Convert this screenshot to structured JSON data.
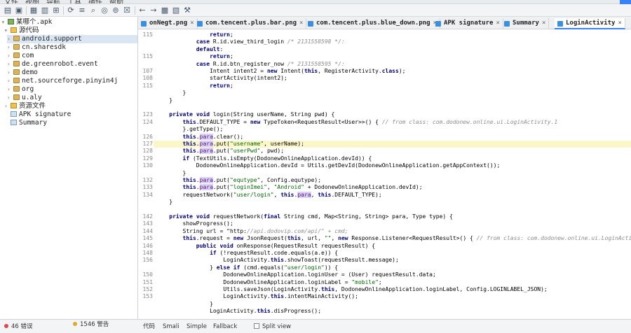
{
  "window": {
    "title_partial": "",
    "menu": [
      "文件",
      "视图",
      "导航",
      "工具",
      "插件",
      "帮助"
    ]
  },
  "toolbar": {
    "icons": [
      "open-icon",
      "add-files-icon",
      "save-icon",
      "save-all-icon",
      "export-icon",
      "sync-icon",
      "flatten-icon",
      "search-icon",
      "search-class-icon",
      "search-text-icon",
      "deobfuscation-icon",
      "back-icon",
      "forward-icon",
      "quark-icon",
      "log-icon",
      "settings-icon"
    ]
  },
  "tree": {
    "root": "某哪个.apk",
    "source_code": "源代码",
    "packages": [
      "android.support",
      "cn.sharesdk",
      "com",
      "de.greenrobot.event",
      "demo",
      "net.sourceforge.pinyin4j",
      "org",
      "u.aly"
    ],
    "resources": "资源文件",
    "apk_signature": "APK signature",
    "summary": "Summary"
  },
  "tabs": [
    {
      "label": "onNegt.png"
    },
    {
      "label": "com.tencent.plus.bar.png"
    },
    {
      "label": "com.tencent.plus.blue_down.png"
    },
    {
      "label": "APK signature"
    },
    {
      "label": "Summary"
    },
    {
      "label": "LoginActivity",
      "active": true
    }
  ],
  "code_lines": [
    {
      "ln": "115",
      "text": "                return;"
    },
    {
      "ln": "",
      "text": "            case R.id.view_third_login /* 2131558598 */:"
    },
    {
      "ln": "",
      "text": "            default:"
    },
    {
      "ln": "115",
      "text": "                return;"
    },
    {
      "ln": "",
      "text": "            case R.id.btn_register_now /* 2131558595 */:"
    },
    {
      "ln": "107",
      "text": "                Intent intent2 = new Intent(this, RegisterActivity.class);"
    },
    {
      "ln": "108",
      "text": "                startActivity(intent2);"
    },
    {
      "ln": "115",
      "text": "                return;"
    },
    {
      "ln": "",
      "text": "        }"
    },
    {
      "ln": "",
      "text": "    }"
    },
    {
      "ln": "",
      "text": ""
    },
    {
      "ln": "123",
      "text": "    private void login(String userName, String pwd) {"
    },
    {
      "ln": "124",
      "text": "        this.DEFAULT_TYPE = new TypeToken<RequestResult<User>>() { // from class: com.dodonew.online.ui.LoginActivity.1"
    },
    {
      "ln": "",
      "text": "        }.getType();"
    },
    {
      "ln": "126",
      "text": "        this.para.clear();"
    },
    {
      "ln": "127",
      "text": "        this.para.put(\"username\", userName);"
    },
    {
      "ln": "128",
      "text": "        this.para.put(\"userPwd\", pwd);"
    },
    {
      "ln": "129",
      "text": "        if (TextUtils.isEmpty(DodonewOnlineApplication.devId)) {"
    },
    {
      "ln": "130",
      "text": "            DodonewOnlineApplication.devId = Utils.getDevId(DodonewOnlineApplication.getAppContext());"
    },
    {
      "ln": "",
      "text": "        }"
    },
    {
      "ln": "132",
      "text": "        this.para.put(\"equtype\", Config.equtype);"
    },
    {
      "ln": "133",
      "text": "        this.para.put(\"loginImei\", \"Android\" + DodonewOnlineApplication.devId);"
    },
    {
      "ln": "134",
      "text": "        requestNetwork(\"user/login\", this.para, this.DEFAULT_TYPE);"
    },
    {
      "ln": "",
      "text": "    }"
    },
    {
      "ln": "",
      "text": ""
    },
    {
      "ln": "142",
      "text": "    private void requestNetwork(final String cmd, Map<String, String> para, Type type) {"
    },
    {
      "ln": "143",
      "text": "        showProgress();"
    },
    {
      "ln": "144",
      "text": "        String url = \"http://api.dodovip.com/api/\" + cmd;"
    },
    {
      "ln": "145",
      "text": "        this.request = new JsonRequest(this, url, \"\", new Response.Listener<RequestResult>() { // from class: com.dodonew.online.ui.LoginActivi"
    },
    {
      "ln": "146",
      "text": "            public void onResponse(RequestResult requestResult) {"
    },
    {
      "ln": "148",
      "text": "                if (!requestResult.code.equals(a.e)) {"
    },
    {
      "ln": "156",
      "text": "                    LoginActivity.this.showToast(requestResult.message);"
    },
    {
      "ln": "",
      "text": "                } else if (cmd.equals(\"user/login\")) {"
    },
    {
      "ln": "150",
      "text": "                    DodonewOnlineApplication.loginUser = (User) requestResult.data;"
    },
    {
      "ln": "151",
      "text": "                    DodonewOnlineApplication.loginLabel = \"mobile\";"
    },
    {
      "ln": "152",
      "text": "                    Utils.saveJson(LoginActivity.this, DodonewOnlineApplication.loginLabel, Config.LOGINLABEL_JSON);"
    },
    {
      "ln": "153",
      "text": "                    LoginActivity.this.intentMainActivity();"
    },
    {
      "ln": "",
      "text": "                }"
    },
    {
      "ln": "",
      "text": "                LoginActivity.this.disProgress();"
    }
  ],
  "highlight_line_index": 15,
  "status": {
    "errors": "46 错误",
    "warnings": "1546 警告",
    "view_tabs": [
      "代码",
      "Smali",
      "Simple",
      "Fallback"
    ],
    "split_view": "Split view"
  },
  "colors": {
    "accent": "#3b82f6",
    "error": "#e04848",
    "warning": "#e0a82e"
  }
}
